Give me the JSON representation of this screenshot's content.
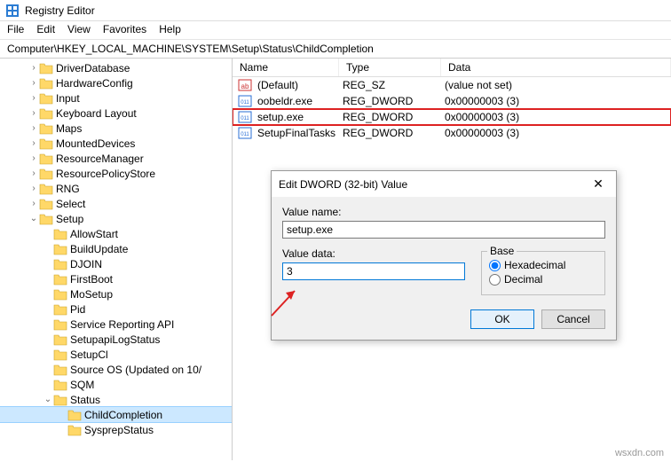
{
  "app": {
    "title": "Registry Editor"
  },
  "menus": [
    "File",
    "Edit",
    "View",
    "Favorites",
    "Help"
  ],
  "address": "Computer\\HKEY_LOCAL_MACHINE\\SYSTEM\\Setup\\Status\\ChildCompletion",
  "tree": [
    {
      "d": 2,
      "e": ">",
      "l": "DriverDatabase"
    },
    {
      "d": 2,
      "e": ">",
      "l": "HardwareConfig"
    },
    {
      "d": 2,
      "e": ">",
      "l": "Input"
    },
    {
      "d": 2,
      "e": ">",
      "l": "Keyboard Layout"
    },
    {
      "d": 2,
      "e": ">",
      "l": "Maps"
    },
    {
      "d": 2,
      "e": ">",
      "l": "MountedDevices"
    },
    {
      "d": 2,
      "e": ">",
      "l": "ResourceManager"
    },
    {
      "d": 2,
      "e": ">",
      "l": "ResourcePolicyStore"
    },
    {
      "d": 2,
      "e": ">",
      "l": "RNG"
    },
    {
      "d": 2,
      "e": ">",
      "l": "Select"
    },
    {
      "d": 2,
      "e": "v",
      "l": "Setup"
    },
    {
      "d": 3,
      "e": "",
      "l": "AllowStart"
    },
    {
      "d": 3,
      "e": "",
      "l": "BuildUpdate"
    },
    {
      "d": 3,
      "e": "",
      "l": "DJOIN"
    },
    {
      "d": 3,
      "e": "",
      "l": "FirstBoot"
    },
    {
      "d": 3,
      "e": "",
      "l": "MoSetup"
    },
    {
      "d": 3,
      "e": "",
      "l": "Pid"
    },
    {
      "d": 3,
      "e": "",
      "l": "Service Reporting API"
    },
    {
      "d": 3,
      "e": "",
      "l": "SetupapiLogStatus"
    },
    {
      "d": 3,
      "e": "",
      "l": "SetupCl"
    },
    {
      "d": 3,
      "e": "",
      "l": "Source OS (Updated on 10/"
    },
    {
      "d": 3,
      "e": "",
      "l": "SQM"
    },
    {
      "d": 3,
      "e": "v",
      "l": "Status"
    },
    {
      "d": 4,
      "e": "",
      "l": "ChildCompletion",
      "sel": true
    },
    {
      "d": 4,
      "e": "",
      "l": "SysprepStatus"
    }
  ],
  "columns": {
    "name": "Name",
    "type": "Type",
    "data": "Data"
  },
  "rows": [
    {
      "kind": "str",
      "name": "(Default)",
      "type": "REG_SZ",
      "data": "(value not set)"
    },
    {
      "kind": "dw",
      "name": "oobeldr.exe",
      "type": "REG_DWORD",
      "data": "0x00000003 (3)"
    },
    {
      "kind": "dw",
      "name": "setup.exe",
      "type": "REG_DWORD",
      "data": "0x00000003 (3)",
      "hl": true
    },
    {
      "kind": "dw",
      "name": "SetupFinalTasks",
      "type": "REG_DWORD",
      "data": "0x00000003 (3)"
    }
  ],
  "dialog": {
    "title": "Edit DWORD (32-bit) Value",
    "valueNameLabel": "Value name:",
    "valueName": "setup.exe",
    "valueDataLabel": "Value data:",
    "valueData": "3",
    "baseLegend": "Base",
    "hexLabel": "Hexadecimal",
    "decLabel": "Decimal",
    "ok": "OK",
    "cancel": "Cancel"
  },
  "watermark": "wsxdn.com"
}
